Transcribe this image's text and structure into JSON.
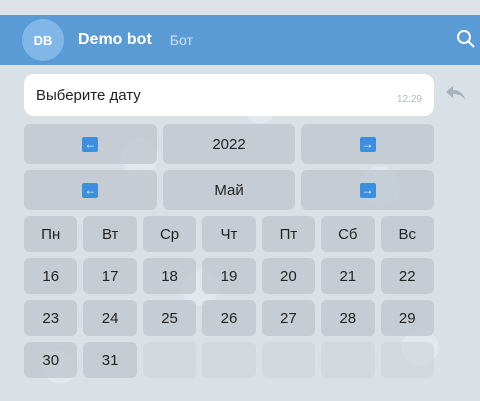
{
  "header": {
    "avatar_initials": "DB",
    "bot_name": "Demo bot",
    "bot_tag": "Бот"
  },
  "message": {
    "text": "Выберите дату",
    "time": "12:29"
  },
  "keyboard": {
    "year_row": {
      "prev": "←",
      "label": "2022",
      "next": "→"
    },
    "month_row": {
      "prev": "←",
      "label": "Май",
      "next": "→"
    },
    "weekdays": [
      "Пн",
      "Вт",
      "Ср",
      "Чт",
      "Пт",
      "Сб",
      "Вс"
    ],
    "weeks": [
      [
        "16",
        "17",
        "18",
        "19",
        "20",
        "21",
        "22"
      ],
      [
        "23",
        "24",
        "25",
        "26",
        "27",
        "28",
        "29"
      ],
      [
        "30",
        "31",
        "",
        "",
        "",
        "",
        ""
      ]
    ]
  },
  "colors": {
    "header": "#5b9bd5",
    "accent": "#3c8fde"
  }
}
